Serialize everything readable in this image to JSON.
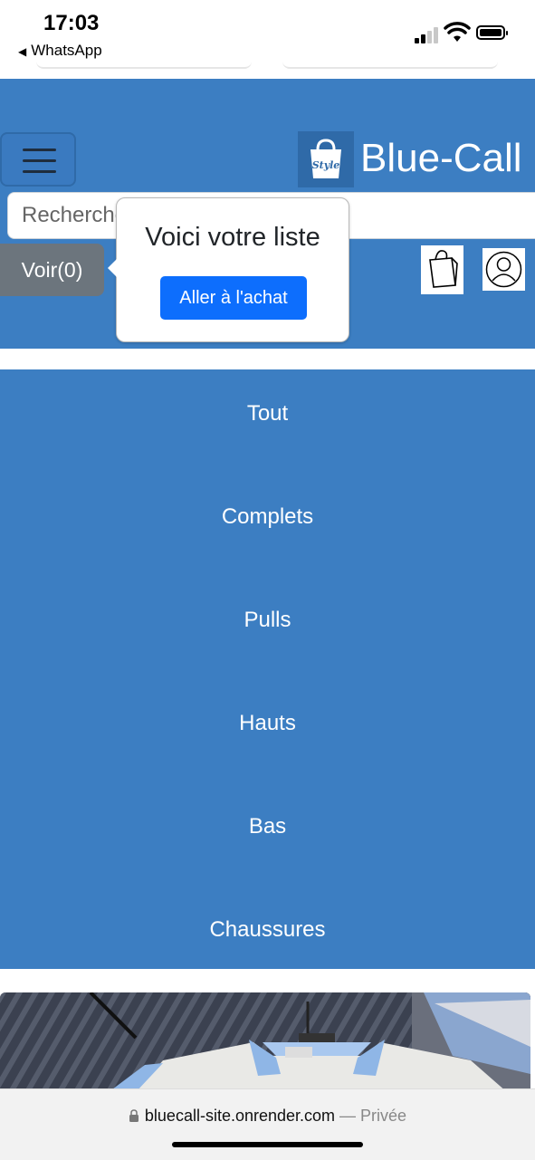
{
  "status_bar": {
    "time": "17:03",
    "back_app": "WhatsApp",
    "icons": [
      "signal-icon",
      "wifi-icon",
      "battery-icon"
    ]
  },
  "header": {
    "brand_name": "Blue-Call",
    "logo_text": "Style",
    "search_placeholder": "Rechercher",
    "view_button": "Voir(0)",
    "icons": [
      "menu-icon",
      "shopping-bag-icon",
      "user-profile-icon"
    ]
  },
  "popover": {
    "title": "Voici votre liste",
    "button": "Aller à l'achat"
  },
  "nav": {
    "items": [
      "Tout",
      "Complets",
      "Pulls",
      "Hauts",
      "Bas",
      "Chaussures"
    ]
  },
  "browser": {
    "url": "bluecall-site.onrender.com",
    "separator": " — ",
    "mode": "Privée"
  },
  "colors": {
    "header_blue": "#3c7ec2",
    "primary_button": "#0d6efd",
    "secondary_button": "#6c757d"
  }
}
